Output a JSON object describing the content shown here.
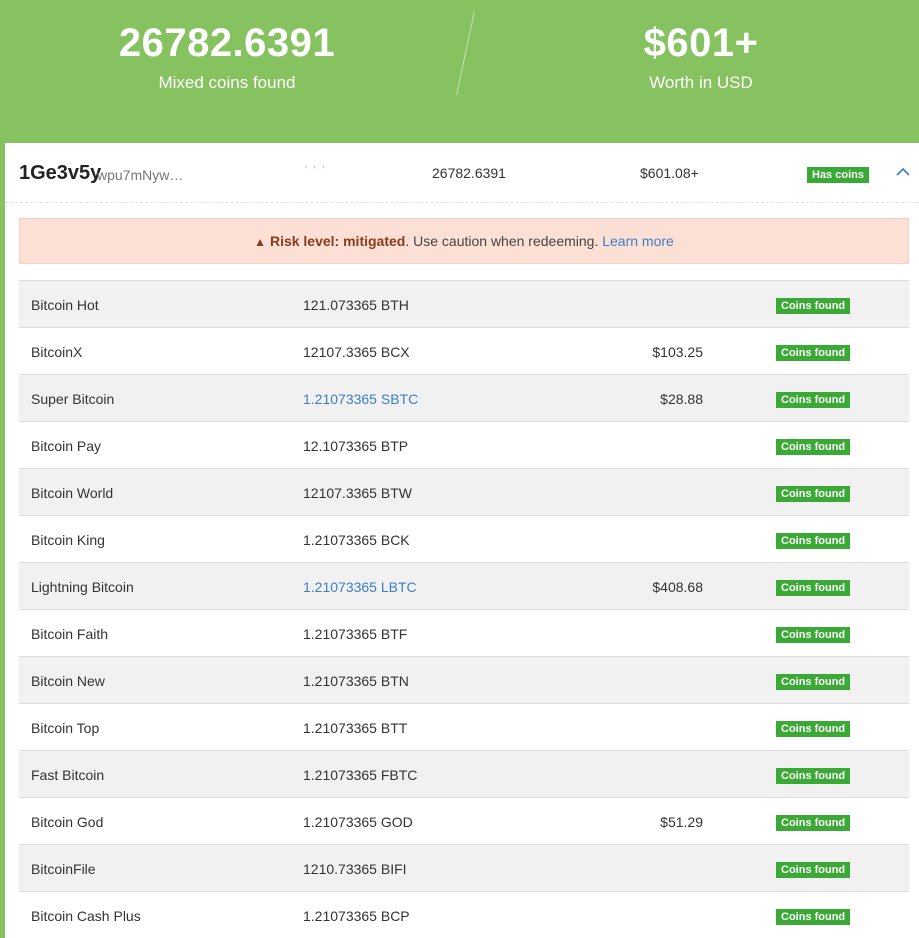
{
  "summary": {
    "coins_value": "26782.6391",
    "coins_label": "Mixed coins found",
    "usd_value": "$601+",
    "usd_label": "Worth in USD"
  },
  "address_row": {
    "address_prefix": "1Ge3v5y",
    "address_rest": "wpu7mNyw…",
    "faint_text": "' ' '",
    "amount": "26782.6391",
    "usd": "$601.08+",
    "badge": "Has coins",
    "toggle_icon": "chevron-up-icon"
  },
  "risk": {
    "icon": "warning-icon",
    "icon_glyph": "▲",
    "level_label": "Risk level: mitigated",
    "message": ". Use caution when redeeming.",
    "link_text": "Learn more"
  },
  "colors": {
    "header_bg": "#86c25f",
    "badge_green": "#3aa935",
    "risk_bg": "#fce0d5",
    "link_blue": "#3b7fc4"
  },
  "coins": [
    {
      "name": "Bitcoin Hot",
      "amount": "121.073365 BTH",
      "usd": "",
      "badge": "Coins found",
      "link": false
    },
    {
      "name": "BitcoinX",
      "amount": "12107.3365 BCX",
      "usd": "$103.25",
      "badge": "Coins found",
      "link": false
    },
    {
      "name": "Super Bitcoin",
      "amount": "1.21073365 SBTC",
      "usd": "$28.88",
      "badge": "Coins found",
      "link": true
    },
    {
      "name": "Bitcoin Pay",
      "amount": "12.1073365 BTP",
      "usd": "",
      "badge": "Coins found",
      "link": false
    },
    {
      "name": "Bitcoin World",
      "amount": "12107.3365 BTW",
      "usd": "",
      "badge": "Coins found",
      "link": false
    },
    {
      "name": "Bitcoin King",
      "amount": "1.21073365 BCK",
      "usd": "",
      "badge": "Coins found",
      "link": false
    },
    {
      "name": "Lightning Bitcoin",
      "amount": "1.21073365 LBTC",
      "usd": "$408.68",
      "badge": "Coins found",
      "link": true
    },
    {
      "name": "Bitcoin Faith",
      "amount": "1.21073365 BTF",
      "usd": "",
      "badge": "Coins found",
      "link": false
    },
    {
      "name": "Bitcoin New",
      "amount": "1.21073365 BTN",
      "usd": "",
      "badge": "Coins found",
      "link": false
    },
    {
      "name": "Bitcoin Top",
      "amount": "1.21073365 BTT",
      "usd": "",
      "badge": "Coins found",
      "link": false
    },
    {
      "name": "Fast Bitcoin",
      "amount": "1.21073365 FBTC",
      "usd": "",
      "badge": "Coins found",
      "link": false
    },
    {
      "name": "Bitcoin God",
      "amount": "1.21073365 GOD",
      "usd": "$51.29",
      "badge": "Coins found",
      "link": false
    },
    {
      "name": "BitcoinFile",
      "amount": "1210.73365 BIFI",
      "usd": "",
      "badge": "Coins found",
      "link": false
    },
    {
      "name": "Bitcoin Cash Plus",
      "amount": "1.21073365 BCP",
      "usd": "",
      "badge": "Coins found",
      "link": false
    }
  ]
}
